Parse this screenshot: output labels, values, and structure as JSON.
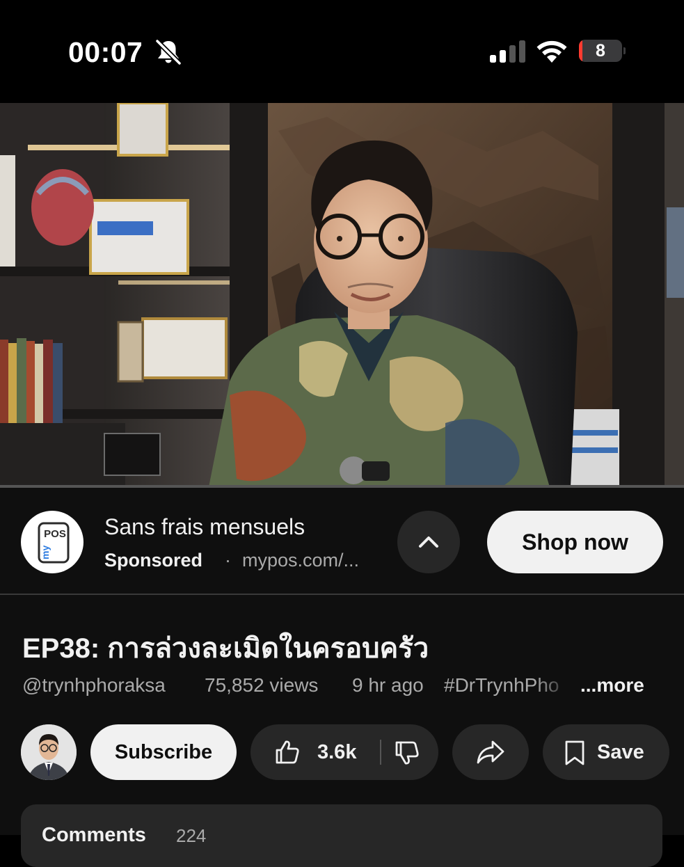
{
  "status_bar": {
    "time": "00:07",
    "silent_mode": true,
    "signal_bars": 2,
    "wifi": true,
    "battery_percent": "8",
    "battery_level": 0.08,
    "battery_color": "#ff3b30"
  },
  "video": {
    "scene": "man-in-glasses-seated-in-office",
    "progress": 0.0,
    "progress_color": "#ff0000"
  },
  "ad": {
    "logo_icon": "mypos-logo",
    "logo_text_top": "POS",
    "logo_text_side": "my",
    "title": "Sans frais mensuels",
    "sponsored_label": "Sponsored",
    "separator": "·",
    "url": "mypos.com/...",
    "expand_icon": "chevron-up-icon",
    "cta_label": "Shop now"
  },
  "video_info": {
    "title": "EP38: การล่วงละเมิดในครอบครัว",
    "channel_handle": "@trynhphoraksa",
    "views": "75,852 views",
    "age": "9 hr ago",
    "hashtag": "#DrTrynhPho",
    "more_label": "...more"
  },
  "actions": {
    "subscribe_label": "Subscribe",
    "like_icon": "thumbs-up-icon",
    "like_count": "3.6k",
    "dislike_icon": "thumbs-down-icon",
    "share_icon": "share-icon",
    "save_icon": "bookmark-icon",
    "save_label": "Save"
  },
  "comments": {
    "title": "Comments",
    "count": "224"
  },
  "colors": {
    "background": "#0f0f0f",
    "pill": "#272727",
    "primary_text": "#f1f1f1",
    "secondary_text": "#aaaaaa",
    "light_button": "#f1f1f1"
  }
}
